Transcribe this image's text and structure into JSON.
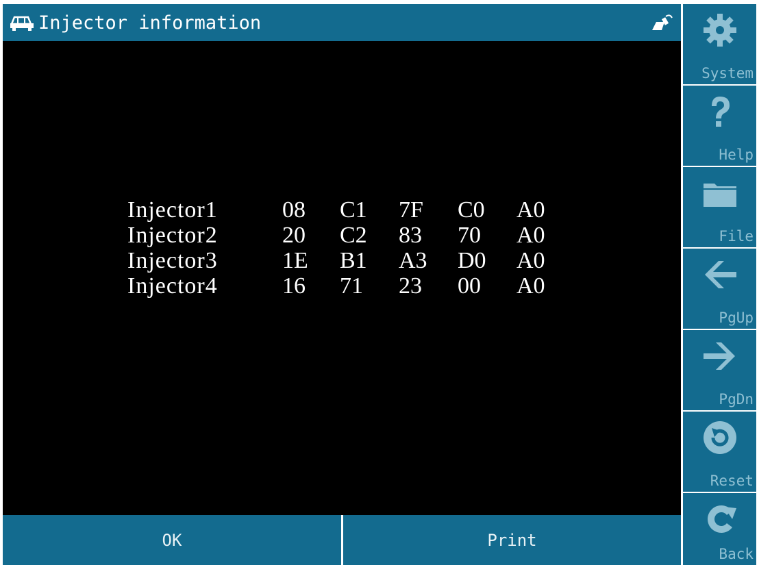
{
  "header": {
    "title": "Injector information",
    "left_icon": "car-icon",
    "right_icon": "connector-plug-icon"
  },
  "injectors": [
    {
      "name": "Injector1",
      "values": [
        "08",
        "C1",
        "7F",
        "C0",
        "A0"
      ]
    },
    {
      "name": "Injector2",
      "values": [
        "20",
        "C2",
        "83",
        "70",
        "A0"
      ]
    },
    {
      "name": "Injector3",
      "values": [
        "1E",
        "B1",
        "A3",
        "D0",
        "A0"
      ]
    },
    {
      "name": "Injector4",
      "values": [
        "16",
        "71",
        "23",
        "00",
        "A0"
      ]
    }
  ],
  "bottom": {
    "ok_label": "OK",
    "print_label": "Print"
  },
  "sidebar": {
    "items": [
      {
        "label": "System",
        "icon": "gear-icon"
      },
      {
        "label": "Help",
        "icon": "question-icon"
      },
      {
        "label": "File",
        "icon": "folder-icon"
      },
      {
        "label": "PgUp",
        "icon": "arrow-left-icon"
      },
      {
        "label": "PgDn",
        "icon": "arrow-right-icon"
      },
      {
        "label": "Reset",
        "icon": "reset-icon"
      },
      {
        "label": "Back",
        "icon": "back-icon"
      }
    ]
  },
  "colors": {
    "bar": "#136b8f",
    "screen": "#000000",
    "text": "#ffffff",
    "sidebar_label": "#8fc0d3"
  }
}
